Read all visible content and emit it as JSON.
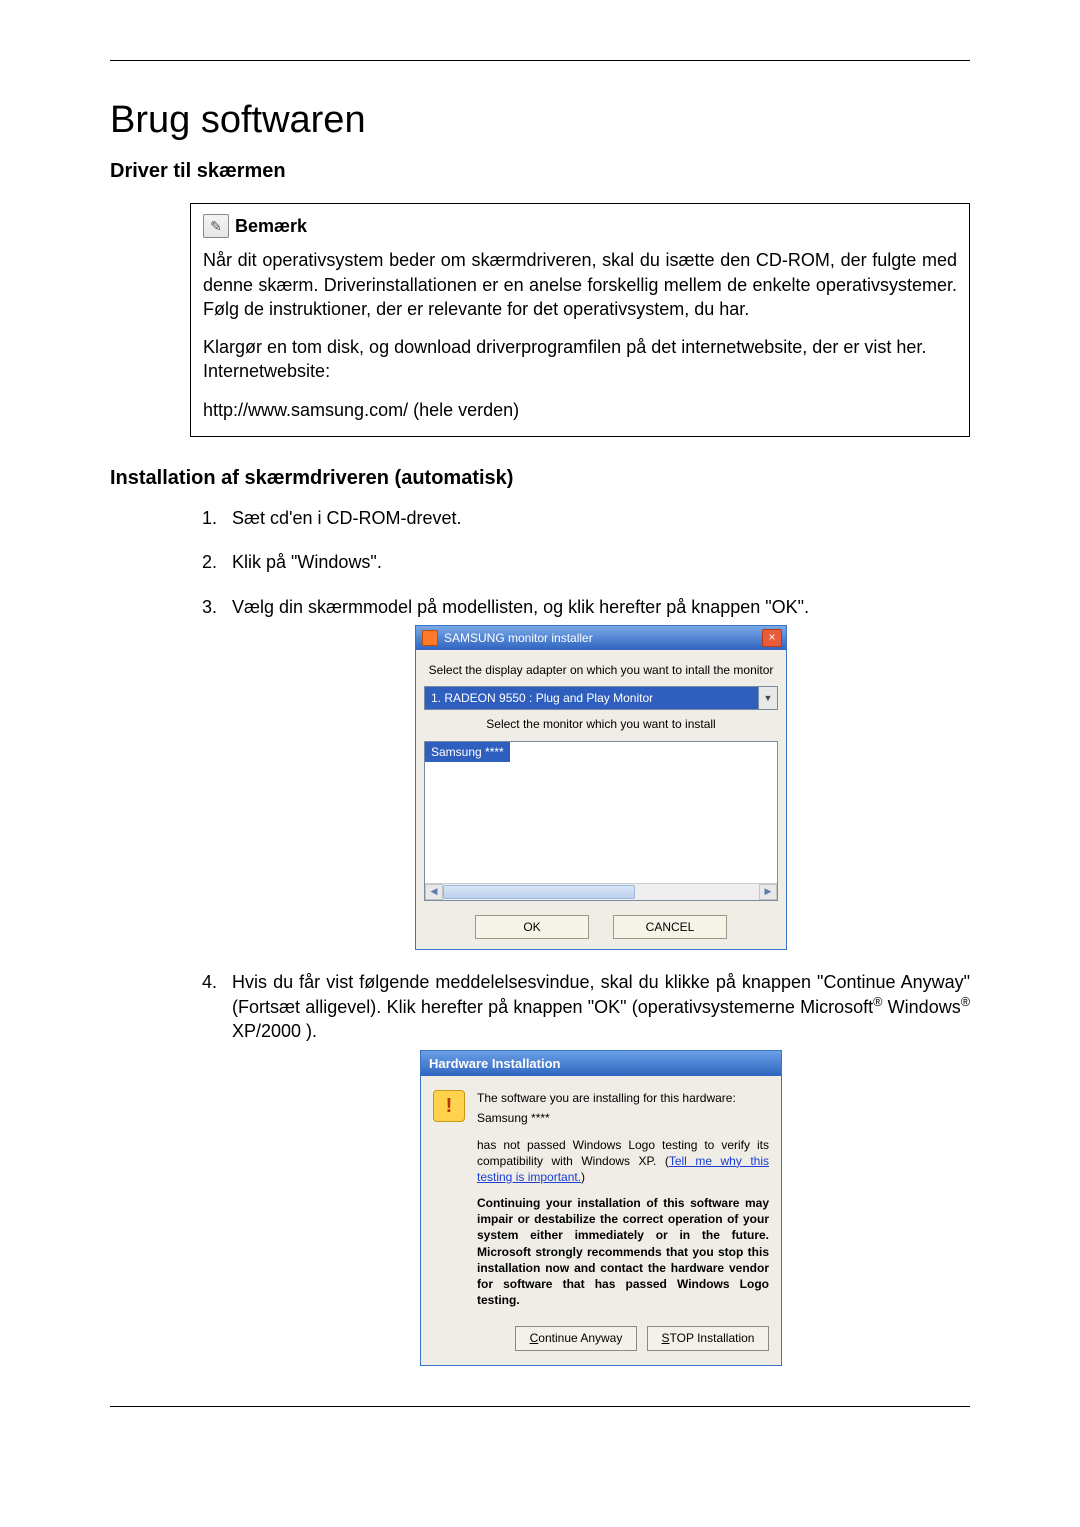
{
  "title": "Brug softwaren",
  "section1_title": "Driver til skærmen",
  "note": {
    "label": "Bemærk",
    "para1": "Når dit operativsystem beder om skærmdriveren, skal du isætte den CD-ROM, der fulgte med denne skærm. Driverinstallationen er en anelse forskellig mellem de enkelte operativsystemer. Følg de instruktioner, der er relevante for det operativsystem, du har.",
    "para2": "Klargør en tom disk, og download driverprogramfilen på det internetwebsite, der er vist her.",
    "link_label": "Internetwebsite:",
    "url": "http://www.samsung.com/ (hele verden)"
  },
  "section2_title": "Installation af skærmdriveren (automatisk)",
  "steps": {
    "s1": "Sæt cd'en i CD-ROM-drevet.",
    "s2": "Klik på \"Windows\".",
    "s3": "Vælg din skærmmodel på modellisten, og klik herefter på knappen \"OK\".",
    "s4_a": "Hvis du får vist følgende meddelelsesvindue, skal du klikke på knappen \"Continue Anyway\" (Fortsæt alligevel). Klik herefter på knappen \"OK\" (operativsystemerne Microsoft",
    "s4_b": " Windows",
    "s4_c": " XP/2000 )."
  },
  "installer": {
    "title": "SAMSUNG monitor installer",
    "label1": "Select the display adapter on which you want to intall the monitor",
    "adapter": "1. RADEON 9550 : Plug and Play Monitor",
    "label2": "Select the monitor which you want to install",
    "list_item": "Samsung ****",
    "ok": "OK",
    "cancel": "CANCEL"
  },
  "hw": {
    "title": "Hardware Installation",
    "line1": "The software you are installing for this hardware:",
    "line2": "Samsung ****",
    "line3a": "has not passed Windows Logo testing to verify its compatibility with Windows XP. (",
    "link": "Tell me why this testing is important.",
    "line3b": ")",
    "bold": "Continuing your installation of this software may impair or destabilize the correct operation of your system either immediately or in the future. Microsoft strongly recommends that you stop this installation now and contact the hardware vendor for software that has passed Windows Logo testing.",
    "btn_continue": "Continue Anyway",
    "btn_stop": "STOP Installation"
  }
}
